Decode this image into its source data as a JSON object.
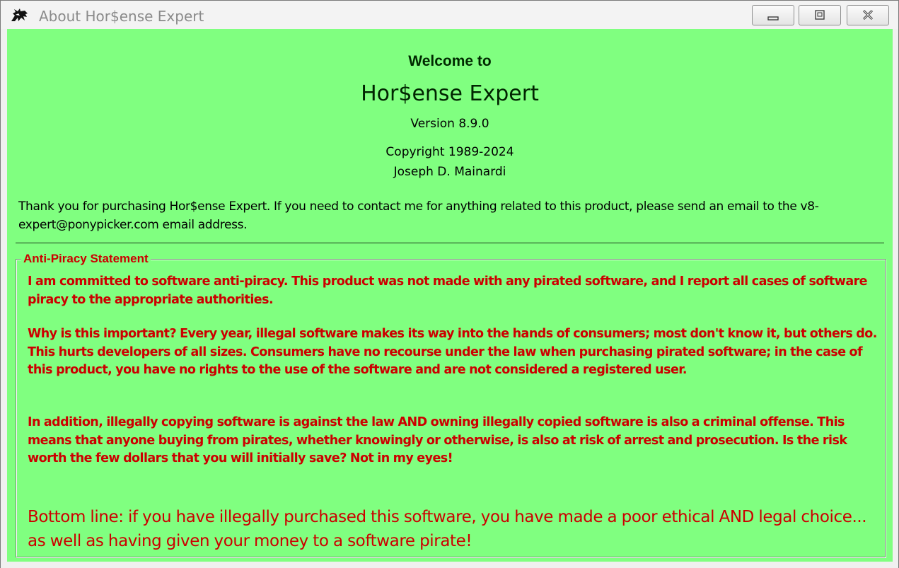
{
  "window": {
    "title": "About Hor$ense Expert",
    "icon": "horse-head-icon",
    "background_color": "#80ff80",
    "controls": {
      "minimize_icon": "minimize-icon",
      "maximize_icon": "maximize-icon",
      "close_icon": "close-icon"
    }
  },
  "header": {
    "welcome": "Welcome to",
    "product_name": "Hor$ense Expert",
    "version": "Version 8.9.0",
    "copyright": "Copyright 1989-2024",
    "author": "Joseph D. Mainardi"
  },
  "thanks_text": "Thank you for purchasing Hor$ense Expert.  If you need to contact me for anything related to this product, please send an email to the v8-expert@ponypicker.com email address.",
  "anti_piracy": {
    "heading": "Anti-Piracy Statement",
    "text_color": "#cc0000",
    "paragraphs": [
      "I am committed to software anti-piracy.  This product was not made with any pirated software, and I report all cases of software piracy to the appropriate authorities.",
      "Why is this important?  Every year, illegal software makes its way into the hands of consumers; most don't know it, but others do.  This hurts developers of all sizes.  Consumers have no recourse under the law when purchasing pirated software; in the case of this product, you have no rights to the use of the software and are not considered a registered user.",
      "In addition, illegally copying software is against the law AND owning illegally copied software is also a criminal offense.  This means that anyone buying from pirates, whether knowingly or otherwise, is also at risk of arrest and prosecution.  Is the risk worth the few dollars that you will initially save?  Not in my eyes!"
    ],
    "bottom_line": "Bottom line: if you have illegally purchased this software, you have made a poor ethical AND legal choice... as well as having given your money to a software pirate!"
  }
}
